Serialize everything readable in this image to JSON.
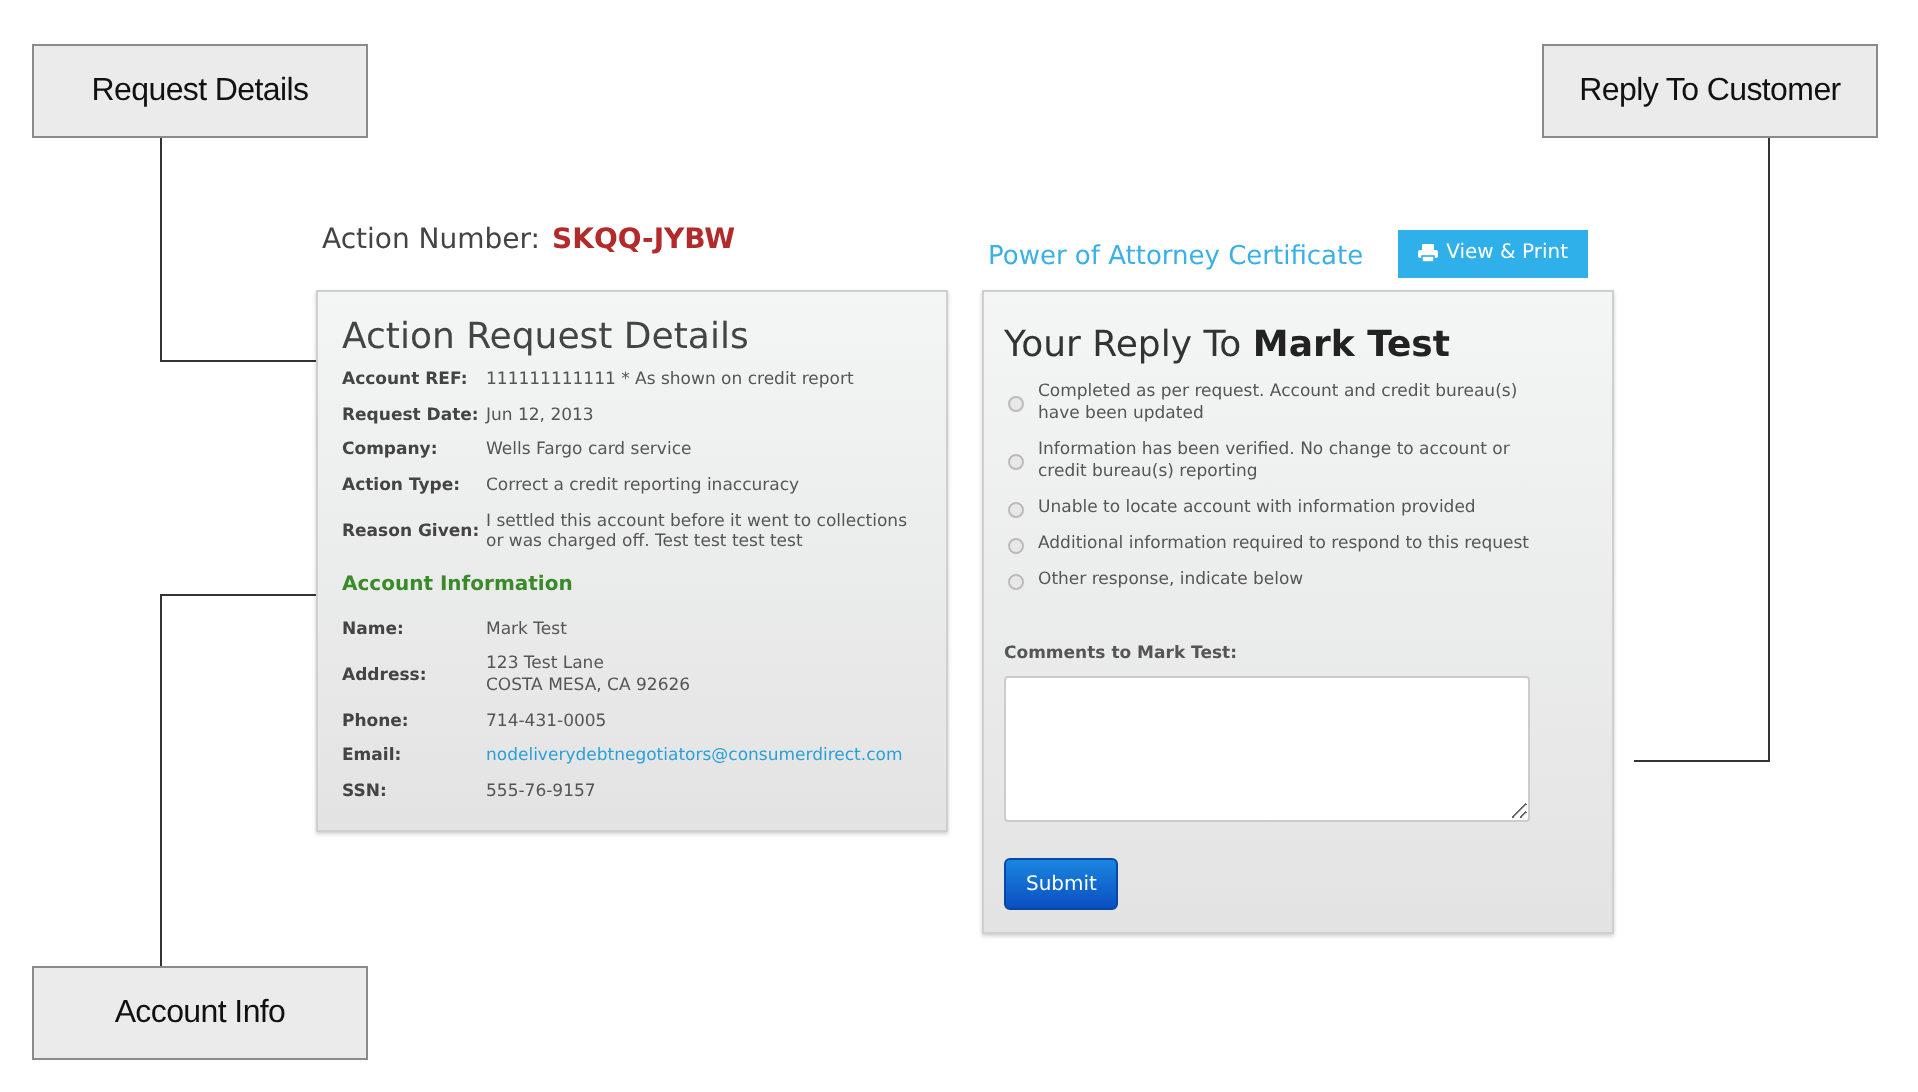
{
  "callouts": [
    {
      "label": "Request Details"
    },
    {
      "label": "Reply To Customer"
    },
    {
      "label": "Account Info"
    }
  ],
  "action_number": {
    "label": "Action Number:",
    "value": "SKQQ-JYBW"
  },
  "request_details": {
    "title": "Action Request Details",
    "fields": [
      {
        "label": "Account REF:",
        "value": "111111111111 * As shown on credit report"
      },
      {
        "label": "Request Date:",
        "value": "Jun 12, 2013"
      },
      {
        "label": "Company:",
        "value": "Wells Fargo card service"
      },
      {
        "label": "Action Type:",
        "value": "Correct a credit reporting inaccuracy"
      },
      {
        "label": "Reason Given:",
        "value": "I settled this account before it went to collections or was charged off. Test test test test"
      }
    ]
  },
  "account_information": {
    "title": "Account Information",
    "fields": [
      {
        "label": "Name:",
        "value": "Mark Test",
        "kind": "text"
      },
      {
        "label": "Address:",
        "value": "123 Test Lane\nCOSTA MESA, CA 92626",
        "kind": "text"
      },
      {
        "label": "Phone:",
        "value": "714-431-0005",
        "kind": "text"
      },
      {
        "label": "Email:",
        "value": "nodeliverydebtnegotiators@consumerdirect.com",
        "kind": "link"
      },
      {
        "label": "SSN:",
        "value": "555-76-9157",
        "kind": "text"
      }
    ]
  },
  "certificate": {
    "title": "Power of Attorney Certificate",
    "button": "View & Print"
  },
  "reply": {
    "title": "Your Reply To **Mark Test**",
    "options": [
      {
        "label": "Completed as per request. Account and credit bureau(s) have been updated",
        "selected": false
      },
      {
        "label": "Information has been verified. No change to account or credit bureau(s) reporting",
        "selected": false
      },
      {
        "label": "Unable to locate account with information provided",
        "selected": false
      },
      {
        "label": "Additional information required to respond to this request",
        "selected": false
      },
      {
        "label": "Other response, indicate below",
        "selected": false
      }
    ],
    "comments_label": "Comments to Mark Test:",
    "submit": "Submit"
  }
}
